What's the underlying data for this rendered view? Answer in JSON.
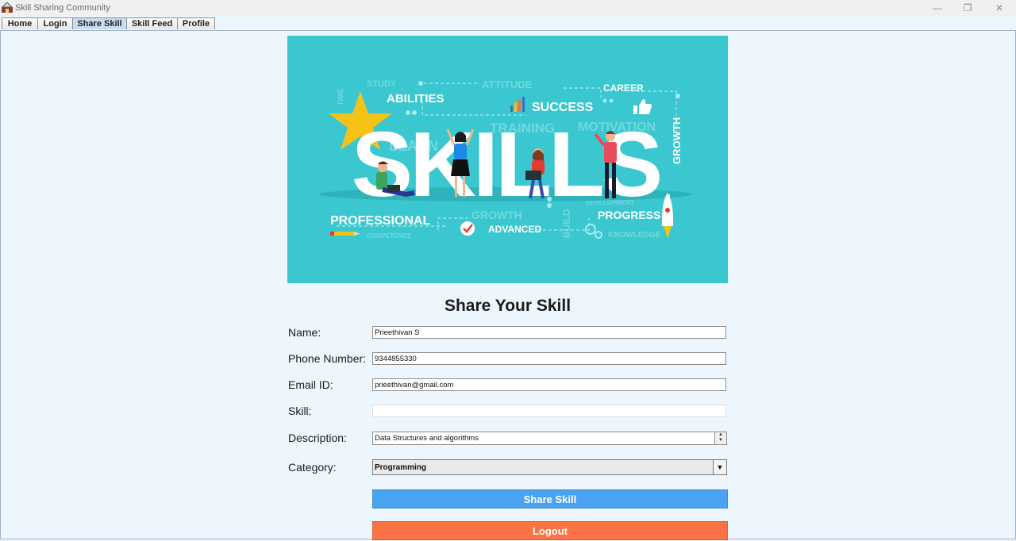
{
  "window": {
    "title": "Skill Sharing Community"
  },
  "tabs": [
    {
      "label": "Home"
    },
    {
      "label": "Login"
    },
    {
      "label": "Share Skill"
    },
    {
      "label": "Skill Feed"
    },
    {
      "label": "Profile"
    }
  ],
  "banner": {
    "main_word": "SKILLS",
    "words": {
      "abilities": "ABILITIES",
      "success": "SUCCESS",
      "career": "CAREER",
      "growth_vertical": "GROWTH",
      "professional": "PROFESSIONAL",
      "progress": "PROGRESS",
      "advanced": "ADVANCED",
      "study": "STUDY",
      "attitude": "ATTITUDE",
      "motivation": "MOTIVATION",
      "training": "TRAINING",
      "knowledge": "KNOWLEDGE",
      "growth": "GROWTH",
      "competence": "COMPETENCE",
      "learn": "LEARN",
      "time": "TIME",
      "build": "BUILD",
      "development": "DEVELOPMENT"
    }
  },
  "form": {
    "title": "Share Your Skill",
    "name_label": "Name:",
    "name_value": "Prieethivan S",
    "phone_label": "Phone Number:",
    "phone_value": "9344855330",
    "email_label": "Email ID:",
    "email_value": "prieethivan@gmail.com",
    "skill_label": "Skill:",
    "skill_value": "",
    "description_label": "Description:",
    "description_value": "Data Structures and algorithms",
    "category_label": "Category:",
    "category_value": "Programming"
  },
  "buttons": {
    "share": "Share Skill",
    "logout": "Logout"
  }
}
